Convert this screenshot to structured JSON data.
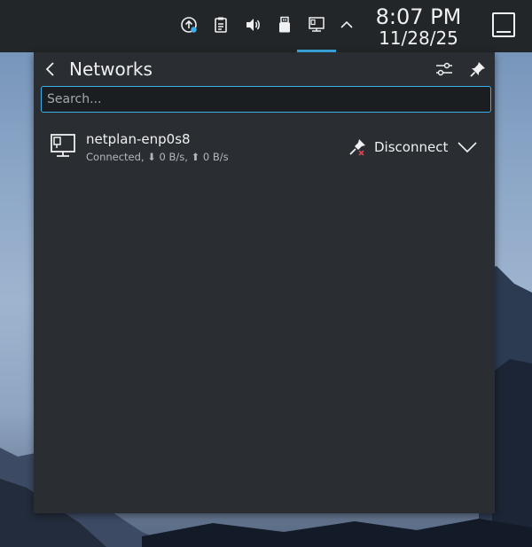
{
  "panel": {
    "tray_icons": [
      "updates-icon",
      "clipboard-icon",
      "volume-icon",
      "usb-drive-icon",
      "network-wired-icon",
      "expand-tray-icon"
    ],
    "clock": {
      "time": "8:07 PM",
      "date": "11/28/25"
    }
  },
  "popup": {
    "title": "Networks",
    "search": {
      "placeholder": "Search...",
      "value": ""
    },
    "networks": [
      {
        "name": "netplan-enp0s8",
        "status": "Connected, ⬇ 0 B/s, ⬆ 0 B/s",
        "action_label": "Disconnect"
      }
    ]
  },
  "colors": {
    "panel_bg": "#232629",
    "popup_bg": "#2a2e32",
    "accent": "#3daee9",
    "text": "#eff0f1",
    "muted_text": "#b4b8bc"
  }
}
